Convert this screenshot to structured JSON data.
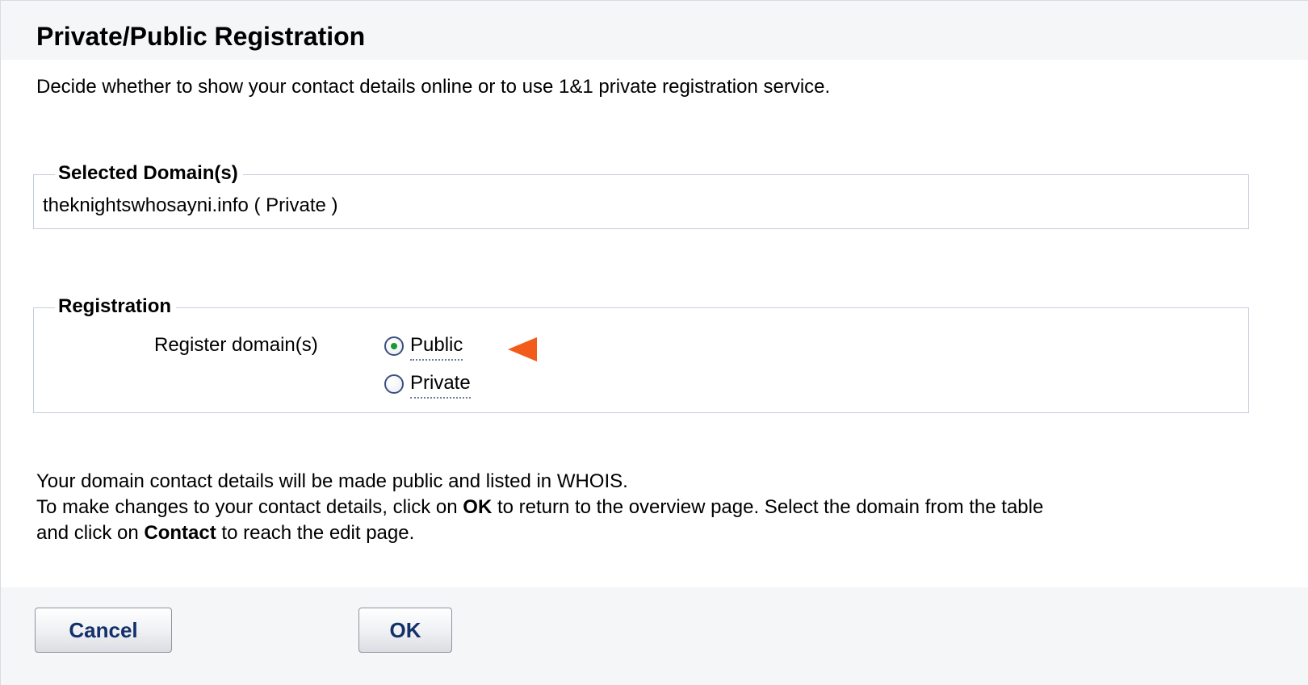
{
  "header": {
    "title": "Private/Public Registration"
  },
  "intro": "Decide whether to show your contact details online or to use 1&1 private registration service.",
  "selected_domains": {
    "legend": "Selected Domain(s)",
    "domain_text": "theknightswhosayni.info ( Private )"
  },
  "registration": {
    "legend": "Registration",
    "label": "Register domain(s)",
    "options": [
      {
        "label": "Public",
        "checked": true
      },
      {
        "label": "Private",
        "checked": false
      }
    ]
  },
  "info": {
    "line1": "Your domain contact details will be made public and listed in WHOIS.",
    "line2_prefix": "To make changes to your contact details, click on ",
    "line2_bold": "OK",
    "line2_suffix": " to return to the overview page. Select the domain from the table",
    "line3_prefix": "and click on ",
    "line3_bold": "Contact",
    "line3_suffix": " to reach the edit page."
  },
  "footer": {
    "cancel_label": "Cancel",
    "ok_label": "OK"
  },
  "colors": {
    "arrow": "#f35b1b",
    "radio_dot": "#1a9a2a",
    "button_text": "#14306b",
    "border": "#c5cedb"
  },
  "icons": {
    "arrow": "arrow-left-icon"
  }
}
